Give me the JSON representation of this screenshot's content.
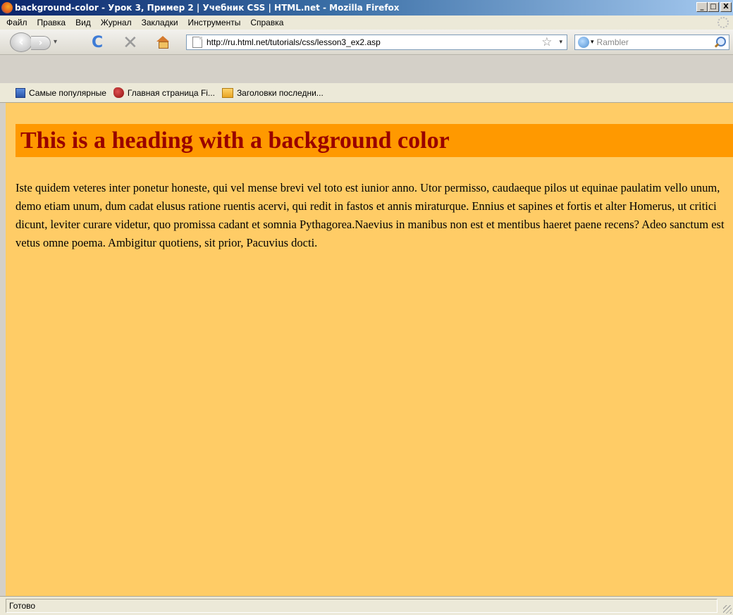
{
  "window": {
    "title": "background-color - Урок 3, Пример 2 | Учебник CSS | HTML.net - Mozilla Firefox",
    "minimize": "_",
    "maximize": "□",
    "close": "X"
  },
  "menu": [
    "Файл",
    "Правка",
    "Вид",
    "Журнал",
    "Закладки",
    "Инструменты",
    "Справка"
  ],
  "navigation": {
    "back_icon": "‹",
    "forward_icon": "›",
    "dropdown_icon": "▾",
    "reload_icon": "C",
    "stop_icon": "✕",
    "url": "http://ru.html.net/tutorials/css/lesson3_ex2.asp",
    "bookmark_star": "☆",
    "search_placeholder": "Rambler"
  },
  "bookmarks": [
    {
      "label": "Самые популярные"
    },
    {
      "label": "Главная страница Fi..."
    },
    {
      "label": "Заголовки последни..."
    }
  ],
  "page": {
    "heading": "This is a heading with a background color",
    "paragraph": "Iste quidem veteres inter ponetur honeste, qui vel mense brevi vel toto est iunior anno. Utor permisso, caudaeque pilos ut equinae paulatim vello unum, demo etiam unum, dum cadat elusus ratione ruentis acervi, qui redit in fastos et annis miraturque. Ennius et sapines et fortis et alter Homerus, ut critici dicunt, leviter curare videtur, quo promissa cadant et somnia Pythagorea.Naevius in manibus non est et mentibus haeret paene recens? Adeo sanctum est vetus omne poema. Ambigitur quotiens, sit prior, Pacuvius docti.",
    "background_color": "#ffcc66",
    "heading_background": "#ff9900",
    "heading_color": "#990000"
  },
  "status": {
    "text": "Готово"
  }
}
